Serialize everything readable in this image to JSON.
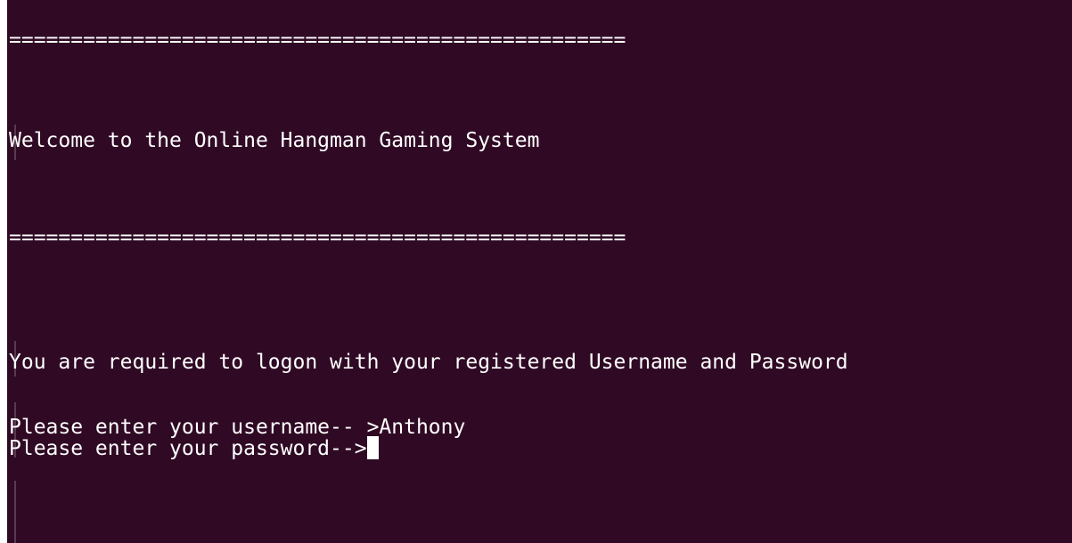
{
  "terminal": {
    "separator_top": "==================================================",
    "welcome": "Welcome to the Online Hangman Gaming System",
    "separator_bottom": "==================================================",
    "logon_instruction": "You are required to logon with your registered Username and Password",
    "username_prompt": "Please enter your username-- >",
    "username_value": "Anthony",
    "password_prompt": "Please enter your password-->",
    "password_value": "",
    "colors": {
      "background": "#300a24",
      "text": "#ffffff"
    }
  }
}
